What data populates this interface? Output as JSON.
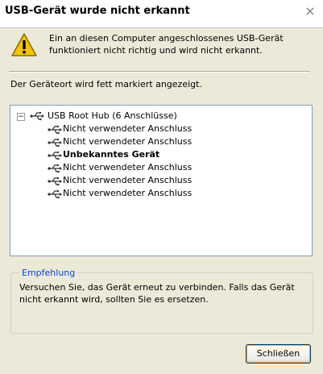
{
  "window": {
    "title": "USB-Gerät wurde nicht erkannt",
    "close_glyph": "×"
  },
  "message": "Ein an diesen Computer angeschlossenes USB-Gerät  funktioniert nicht richtig und wird nicht erkannt.",
  "location_label": "Der Geräteort wird fett markiert angezeigt.",
  "tree": {
    "expander": "−",
    "root": "USB Root Hub (6 Anschlüsse)",
    "ports": [
      "Nicht verwendeter Anschluss",
      "Nicht verwendeter Anschluss",
      "Unbekanntes Gerät",
      "Nicht verwendeter Anschluss",
      "Nicht verwendeter Anschluss",
      "Nicht verwendeter Anschluss"
    ]
  },
  "recommendation": {
    "title": "Empfehlung",
    "text": "Versuchen Sie, das Gerät erneut zu verbinden. Falls das Gerät nicht erkannt wird, sollten Sie es ersetzen."
  },
  "button": {
    "close_label": "Schließen"
  },
  "colors": {
    "accent": "#0046d5",
    "dialog_bg": "#ece9d8",
    "warning": "#f4c300"
  },
  "icons": {
    "warning": "warning-icon",
    "usb": "usb-icon"
  }
}
